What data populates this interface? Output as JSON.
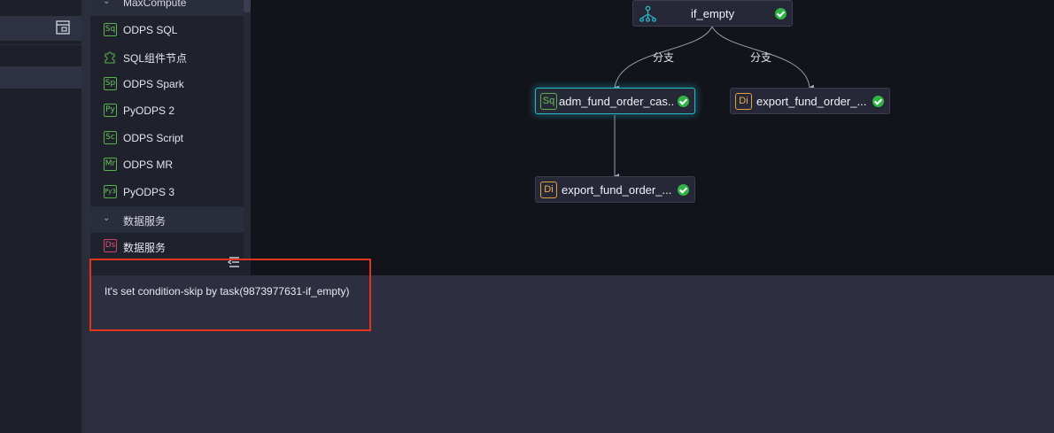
{
  "sidebar_palette": {
    "groups": [
      {
        "label": "MaxCompute"
      },
      {
        "label": "数据服务"
      }
    ],
    "items": [
      {
        "icon": "Sq",
        "label": "ODPS SQL"
      },
      {
        "icon": "puzzle",
        "label": "SQL组件节点"
      },
      {
        "icon": "Sp",
        "label": "ODPS Spark"
      },
      {
        "icon": "Py",
        "label": "PyODPS 2"
      },
      {
        "icon": "Sc",
        "label": "ODPS Script"
      },
      {
        "icon": "Mr",
        "label": "ODPS MR"
      },
      {
        "icon": "Py3",
        "label": "PyODPS 3"
      },
      {
        "icon": "Ds",
        "label": "数据服务"
      }
    ]
  },
  "graph": {
    "edge_labels": [
      "分支",
      "分支"
    ],
    "nodes": [
      {
        "icon": "branch-icon",
        "label": "if_empty",
        "status": "success"
      },
      {
        "icon": "Sq",
        "label": "adm_fund_order_cas...",
        "status": "success",
        "selected": true
      },
      {
        "icon": "Di",
        "label": "export_fund_order_...",
        "status": "success"
      },
      {
        "icon": "Di",
        "label": "export_fund_order_...",
        "status": "success"
      }
    ]
  },
  "log": {
    "message": "It's set condition-skip by task(9873977631-if_empty)"
  },
  "colors": {
    "success": "#2fb446",
    "selected_border": "#27b9c8",
    "highlight_box": "#e0341c",
    "sql_icon": "#5ab14a",
    "di_icon": "#e0a23c"
  }
}
